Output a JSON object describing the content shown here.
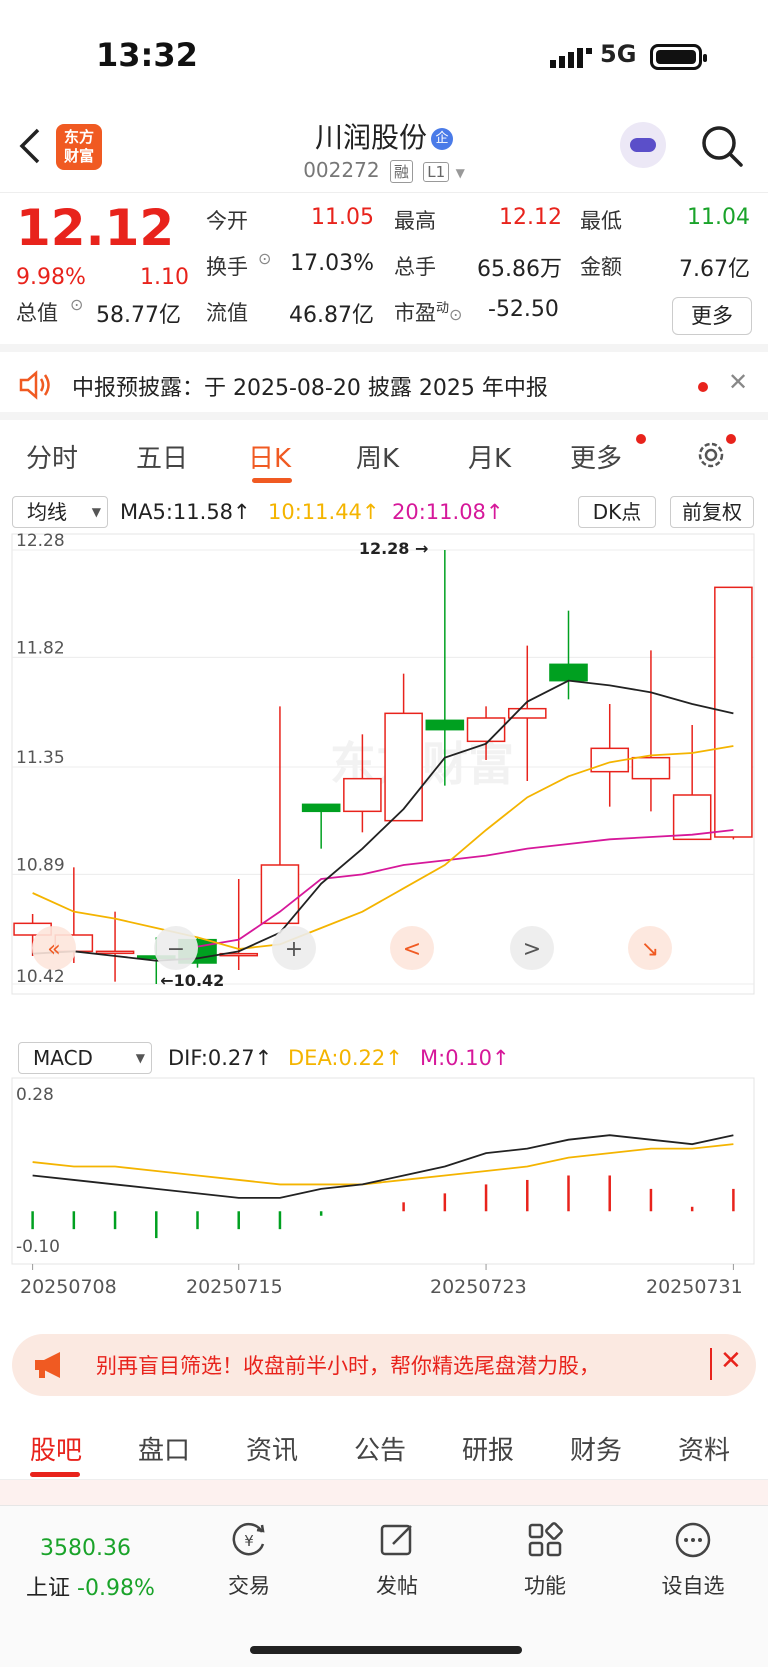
{
  "status": {
    "time": "13:32",
    "network": "5G"
  },
  "header": {
    "logo_line1": "东方",
    "logo_line2": "财富",
    "stock_name": "川润股份",
    "qi_badge": "企",
    "stock_code": "002272",
    "tag_rong": "融",
    "tag_level": "L1"
  },
  "quote": {
    "price": "12.12",
    "change_pct": "9.98%",
    "change": "1.10",
    "open_label": "今开",
    "open": "11.05",
    "high_label": "最高",
    "high": "12.12",
    "low_label": "最低",
    "low": "11.04",
    "turnover_label": "换手",
    "turnover": "17.03%",
    "volume_label": "总手",
    "volume": "65.86万",
    "amount_label": "金额",
    "amount": "7.67亿",
    "mktcap_label": "总值",
    "mktcap": "58.77亿",
    "float_label": "流值",
    "float": "46.87亿",
    "pe_label": "市盈",
    "pe_sup": "动",
    "pe": "-52.50",
    "more": "更多"
  },
  "notice": {
    "text": "中报预披露：于 2025-08-20 披露 2025 年中报"
  },
  "tabs": [
    "分时",
    "五日",
    "日K",
    "周K",
    "月K",
    "更多"
  ],
  "active_tab": "日K",
  "chart_controls": {
    "indicator": "均线",
    "ma5": "MA5:11.58↑",
    "ma10": "10:11.44↑",
    "ma20": "20:11.08↑",
    "dk": "DK点",
    "adjust": "前复权"
  },
  "chart_data": [
    {
      "type": "candlestick",
      "dates": [
        "20250708",
        "20250709",
        "20250710",
        "20250711",
        "20250714",
        "20250715",
        "20250716",
        "20250717",
        "20250718",
        "20250721",
        "20250722",
        "20250723",
        "20250724",
        "20250725",
        "20250728",
        "20250729",
        "20250730",
        "20250731"
      ],
      "open": [
        10.63,
        10.56,
        10.56,
        10.54,
        10.61,
        10.55,
        10.68,
        11.19,
        11.16,
        11.12,
        11.55,
        11.46,
        11.56,
        11.79,
        11.33,
        11.3,
        11.04,
        11.05
      ],
      "close": [
        10.68,
        10.63,
        10.56,
        10.53,
        10.51,
        10.55,
        10.93,
        11.16,
        11.3,
        11.58,
        11.51,
        11.56,
        11.6,
        11.72,
        11.43,
        11.39,
        11.23,
        12.12
      ],
      "high": [
        10.72,
        10.92,
        10.73,
        10.62,
        10.62,
        10.87,
        11.61,
        11.19,
        11.49,
        11.75,
        12.28,
        11.61,
        11.87,
        12.02,
        11.62,
        11.85,
        11.53,
        12.12
      ],
      "low": [
        10.54,
        10.51,
        10.43,
        10.42,
        10.49,
        10.48,
        10.71,
        11.0,
        11.07,
        11.25,
        11.27,
        11.38,
        11.29,
        11.64,
        11.18,
        11.16,
        11.04,
        11.04
      ],
      "ma5": [
        10.55,
        10.56,
        10.54,
        10.52,
        10.53,
        10.56,
        10.64,
        10.85,
        11.0,
        11.17,
        11.39,
        11.45,
        11.63,
        11.72,
        11.7,
        11.67,
        11.62,
        11.58
      ],
      "ma10": [
        10.81,
        10.73,
        10.7,
        10.66,
        10.62,
        10.57,
        10.59,
        10.66,
        10.73,
        10.83,
        10.93,
        11.08,
        11.22,
        11.31,
        11.37,
        11.4,
        11.41,
        11.44
      ],
      "ma20": [
        null,
        null,
        null,
        null,
        10.58,
        10.61,
        10.73,
        10.87,
        10.89,
        10.93,
        10.95,
        10.97,
        11.0,
        11.02,
        11.04,
        11.05,
        11.06,
        11.08
      ],
      "ylabels": [
        "12.28",
        "11.82",
        "11.35",
        "10.89",
        "10.42"
      ],
      "ylim": [
        10.42,
        12.28
      ],
      "annotations": {
        "max": "12.28",
        "min": "10.42"
      }
    },
    {
      "type": "bar",
      "title": "MACD",
      "dif_label": "DIF:0.27↑",
      "dea_label": "DEA:0.22↑",
      "m_label": "M:0.10↑",
      "ylabels": [
        "0.28",
        "-0.10"
      ],
      "ylim": [
        -0.1,
        0.28
      ],
      "dif": [
        0.08,
        0.07,
        0.06,
        0.05,
        0.04,
        0.03,
        0.03,
        0.05,
        0.06,
        0.08,
        0.1,
        0.13,
        0.14,
        0.16,
        0.17,
        0.16,
        0.15,
        0.17
      ],
      "dea": [
        0.11,
        0.1,
        0.1,
        0.09,
        0.08,
        0.07,
        0.06,
        0.06,
        0.06,
        0.07,
        0.08,
        0.09,
        0.1,
        0.12,
        0.13,
        0.14,
        0.14,
        0.15
      ],
      "macd": [
        -0.04,
        -0.04,
        -0.04,
        -0.06,
        -0.04,
        -0.04,
        -0.04,
        -0.01,
        0.0,
        0.02,
        0.04,
        0.06,
        0.07,
        0.08,
        0.08,
        0.05,
        0.01,
        0.05
      ]
    }
  ],
  "date_labels": [
    "20250708",
    "20250715",
    "20250723",
    "20250731"
  ],
  "chart_buttons": [
    "«",
    "−",
    "+",
    "<",
    ">",
    "↘"
  ],
  "promo": {
    "text": "别再盲目筛选！收盘前半小时，帮你精选尾盘潜力股，"
  },
  "subtabs": [
    "股吧",
    "盘口",
    "资讯",
    "公告",
    "研报",
    "财务",
    "资料"
  ],
  "bottom": {
    "index_value": "3580.36",
    "index_name": "上证",
    "index_change": "-0.98%",
    "items": [
      "交易",
      "发帖",
      "功能",
      "设自选"
    ]
  },
  "colors": {
    "up": "#e8231c",
    "down": "#00a020",
    "ma5": "#222222",
    "ma10": "#f4b400",
    "ma20": "#d6189a",
    "accent": "#f05a22"
  }
}
